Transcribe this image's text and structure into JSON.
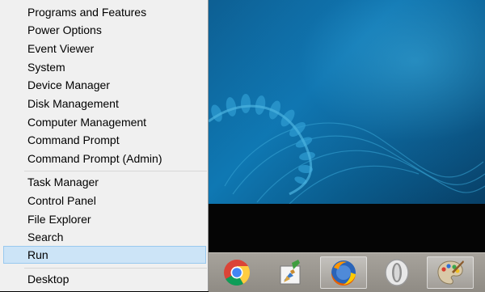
{
  "context_menu": {
    "group1": [
      "Programs and Features",
      "Power Options",
      "Event Viewer",
      "System",
      "Device Manager",
      "Disk Management",
      "Computer Management",
      "Command Prompt",
      "Command Prompt (Admin)"
    ],
    "group2": [
      "Task Manager",
      "Control Panel",
      "File Explorer",
      "Search",
      "Run"
    ],
    "group3": [
      "Desktop"
    ],
    "selected_item": "Run"
  },
  "taskbar": {
    "apps": [
      {
        "name": "chrome-icon",
        "active": false
      },
      {
        "name": "paint-brush-icon",
        "active": false
      },
      {
        "name": "firefox-icon",
        "active": true
      },
      {
        "name": "opera-icon",
        "active": false
      },
      {
        "name": "palette-icon",
        "active": true
      }
    ]
  },
  "colors": {
    "menu_bg": "#f0f0f0",
    "selection_bg": "#cce4f7",
    "selection_border": "#99c9ef",
    "wallpaper": "#0f78b3",
    "taskbar": "#9c988f"
  }
}
